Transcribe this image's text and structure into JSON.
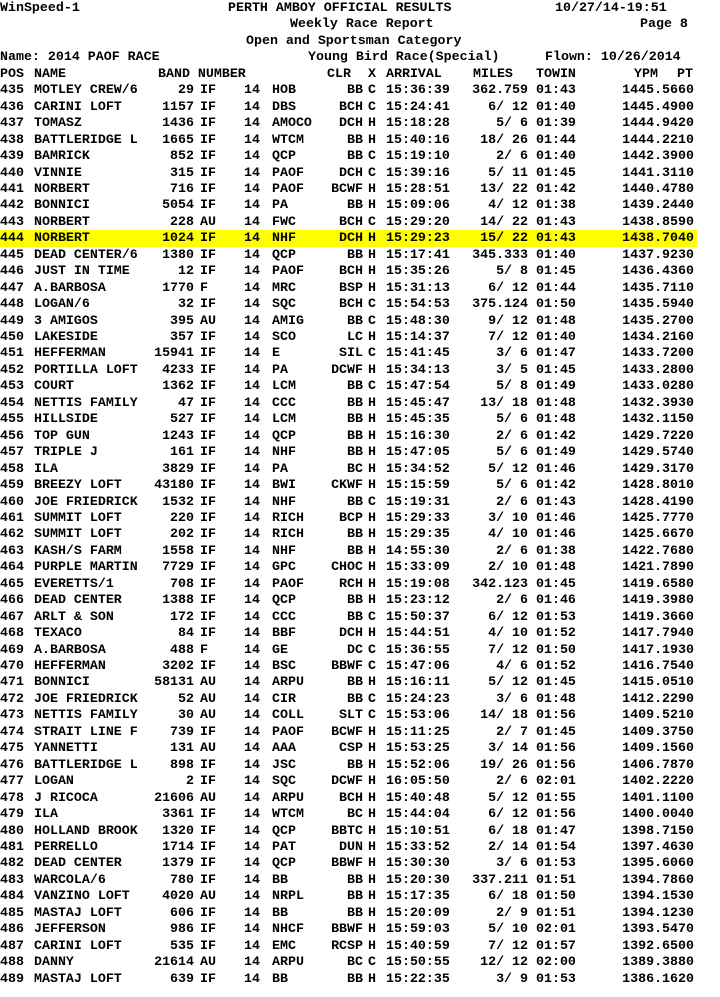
{
  "header": {
    "app": "WinSpeed-1",
    "org": "PERTH AMBOY OFFICIAL RESULTS",
    "datetime": "10/27/14-19:51",
    "report": "Weekly Race Report",
    "page": "Page 8",
    "category": "Open and Sportsman Category",
    "name": "Name: 2014 PAOF RACE",
    "race": "Young Bird Race(Special)",
    "flown": "Flown: 10/26/2014"
  },
  "columns": [
    "POS",
    "NAME",
    "BAND NUMBER",
    "CLR",
    "X",
    "ARRIVAL",
    "MILES",
    "TOWIN",
    "YPM",
    "PT"
  ],
  "highlight_pos": "444",
  "rows": [
    [
      "435",
      "MOTLEY CREW/6",
      "29",
      "IF",
      "14",
      "HOB",
      "BB",
      "C",
      "15:36:39",
      "362.759",
      "01:43",
      "1445.566",
      "0"
    ],
    [
      "436",
      "CARINI LOFT",
      "1157",
      "IF",
      "14",
      "DBS",
      "BCH",
      "C",
      "15:24:41",
      "6/ 12",
      "01:40",
      "1445.490",
      "0"
    ],
    [
      "437",
      "TOMASZ",
      "1436",
      "IF",
      "14",
      "AMOCO",
      "DCH",
      "H",
      "15:18:28",
      "5/ 6",
      "01:39",
      "1444.942",
      "0"
    ],
    [
      "438",
      "BATTLERIDGE L",
      "1665",
      "IF",
      "14",
      "WTCM",
      "BB",
      "H",
      "15:40:16",
      "18/ 26",
      "01:44",
      "1444.221",
      "0"
    ],
    [
      "439",
      "BAMRICK",
      "852",
      "IF",
      "14",
      "QCP",
      "BB",
      "C",
      "15:19:10",
      "2/ 6",
      "01:40",
      "1442.390",
      "0"
    ],
    [
      "440",
      "VINNIE",
      "315",
      "IF",
      "14",
      "PAOF",
      "DCH",
      "C",
      "15:39:16",
      "5/ 11",
      "01:45",
      "1441.311",
      "0"
    ],
    [
      "441",
      "NORBERT",
      "716",
      "IF",
      "14",
      "PAOF",
      "BCWF",
      "H",
      "15:28:51",
      "13/ 22",
      "01:42",
      "1440.478",
      "0"
    ],
    [
      "442",
      "BONNICI",
      "5054",
      "IF",
      "14",
      "PA",
      "BB",
      "H",
      "15:09:06",
      "4/ 12",
      "01:38",
      "1439.244",
      "0"
    ],
    [
      "443",
      "NORBERT",
      "228",
      "AU",
      "14",
      "FWC",
      "BCH",
      "C",
      "15:29:20",
      "14/ 22",
      "01:43",
      "1438.859",
      "0"
    ],
    [
      "444",
      "NORBERT",
      "1024",
      "IF",
      "14",
      "NHF",
      "DCH",
      "H",
      "15:29:23",
      "15/ 22",
      "01:43",
      "1438.704",
      "0"
    ],
    [
      "445",
      "DEAD CENTER/6",
      "1380",
      "IF",
      "14",
      "QCP",
      "BB",
      "H",
      "15:17:41",
      "345.333",
      "01:40",
      "1437.923",
      "0"
    ],
    [
      "446",
      "JUST IN TIME",
      "12",
      "IF",
      "14",
      "PAOF",
      "BCH",
      "H",
      "15:35:26",
      "5/ 8",
      "01:45",
      "1436.436",
      "0"
    ],
    [
      "447",
      "A.BARBOSA",
      "1770",
      "F",
      "14",
      "MRC",
      "BSP",
      "H",
      "15:31:13",
      "6/ 12",
      "01:44",
      "1435.711",
      "0"
    ],
    [
      "448",
      "LOGAN/6",
      "32",
      "IF",
      "14",
      "SQC",
      "BCH",
      "C",
      "15:54:53",
      "375.124",
      "01:50",
      "1435.594",
      "0"
    ],
    [
      "449",
      "3 AMIGOS",
      "395",
      "AU",
      "14",
      "AMIG",
      "BB",
      "C",
      "15:48:30",
      "9/ 12",
      "01:48",
      "1435.270",
      "0"
    ],
    [
      "450",
      "LAKESIDE",
      "357",
      "IF",
      "14",
      "SCO",
      "LC",
      "H",
      "15:14:37",
      "7/ 12",
      "01:40",
      "1434.216",
      "0"
    ],
    [
      "451",
      "HEFFERMAN",
      "15941",
      "IF",
      "14",
      "E",
      "SIL",
      "C",
      "15:41:45",
      "3/ 6",
      "01:47",
      "1433.720",
      "0"
    ],
    [
      "452",
      "PORTILLA LOFT",
      "4233",
      "IF",
      "14",
      "PA",
      "DCWF",
      "H",
      "15:34:13",
      "3/ 5",
      "01:45",
      "1433.280",
      "0"
    ],
    [
      "453",
      "COURT",
      "1362",
      "IF",
      "14",
      "LCM",
      "BB",
      "C",
      "15:47:54",
      "5/ 8",
      "01:49",
      "1433.028",
      "0"
    ],
    [
      "454",
      "NETTIS FAMILY",
      "47",
      "IF",
      "14",
      "CCC",
      "BB",
      "H",
      "15:45:47",
      "13/ 18",
      "01:48",
      "1432.393",
      "0"
    ],
    [
      "455",
      "HILLSIDE",
      "527",
      "IF",
      "14",
      "LCM",
      "BB",
      "H",
      "15:45:35",
      "5/ 6",
      "01:48",
      "1432.115",
      "0"
    ],
    [
      "456",
      "TOP GUN",
      "1243",
      "IF",
      "14",
      "QCP",
      "BB",
      "H",
      "15:16:30",
      "2/ 6",
      "01:42",
      "1429.722",
      "0"
    ],
    [
      "457",
      "TRIPLE J",
      "161",
      "IF",
      "14",
      "NHF",
      "BB",
      "H",
      "15:47:05",
      "5/ 6",
      "01:49",
      "1429.574",
      "0"
    ],
    [
      "458",
      "ILA",
      "3829",
      "IF",
      "14",
      "PA",
      "BC",
      "H",
      "15:34:52",
      "5/ 12",
      "01:46",
      "1429.317",
      "0"
    ],
    [
      "459",
      "BREEZY LOFT",
      "43180",
      "IF",
      "14",
      "BWI",
      "CKWF",
      "H",
      "15:15:59",
      "5/ 6",
      "01:42",
      "1428.801",
      "0"
    ],
    [
      "460",
      "JOE FRIEDRICK",
      "1532",
      "IF",
      "14",
      "NHF",
      "BB",
      "C",
      "15:19:31",
      "2/ 6",
      "01:43",
      "1428.419",
      "0"
    ],
    [
      "461",
      "SUMMIT LOFT",
      "220",
      "IF",
      "14",
      "RICH",
      "BCP",
      "H",
      "15:29:33",
      "3/ 10",
      "01:46",
      "1425.777",
      "0"
    ],
    [
      "462",
      "SUMMIT LOFT",
      "202",
      "IF",
      "14",
      "RICH",
      "BB",
      "H",
      "15:29:35",
      "4/ 10",
      "01:46",
      "1425.667",
      "0"
    ],
    [
      "463",
      "KASH/S FARM",
      "1558",
      "IF",
      "14",
      "NHF",
      "BB",
      "H",
      "14:55:30",
      "2/ 6",
      "01:38",
      "1422.768",
      "0"
    ],
    [
      "464",
      "PURPLE MARTIN",
      "7729",
      "IF",
      "14",
      "GPC",
      "CHOC",
      "H",
      "15:33:09",
      "2/ 10",
      "01:48",
      "1421.789",
      "0"
    ],
    [
      "465",
      "EVERETTS/1",
      "708",
      "IF",
      "14",
      "PAOF",
      "RCH",
      "H",
      "15:19:08",
      "342.123",
      "01:45",
      "1419.658",
      "0"
    ],
    [
      "466",
      "DEAD CENTER",
      "1388",
      "IF",
      "14",
      "QCP",
      "BB",
      "H",
      "15:23:12",
      "2/ 6",
      "01:46",
      "1419.398",
      "0"
    ],
    [
      "467",
      "ARLT & SON",
      "172",
      "IF",
      "14",
      "CCC",
      "BB",
      "C",
      "15:50:37",
      "6/ 12",
      "01:53",
      "1419.366",
      "0"
    ],
    [
      "468",
      "TEXACO",
      "84",
      "IF",
      "14",
      "BBF",
      "DCH",
      "H",
      "15:44:51",
      "4/ 10",
      "01:52",
      "1417.794",
      "0"
    ],
    [
      "469",
      "A.BARBOSA",
      "488",
      "F",
      "14",
      "GE",
      "DC",
      "C",
      "15:36:55",
      "7/ 12",
      "01:50",
      "1417.193",
      "0"
    ],
    [
      "470",
      "HEFFERMAN",
      "3202",
      "IF",
      "14",
      "BSC",
      "BBWF",
      "C",
      "15:47:06",
      "4/ 6",
      "01:52",
      "1416.754",
      "0"
    ],
    [
      "471",
      "BONNICI",
      "58131",
      "AU",
      "14",
      "ARPU",
      "BB",
      "H",
      "15:16:11",
      "5/ 12",
      "01:45",
      "1415.051",
      "0"
    ],
    [
      "472",
      "JOE FRIEDRICK",
      "52",
      "AU",
      "14",
      "CIR",
      "BB",
      "C",
      "15:24:23",
      "3/ 6",
      "01:48",
      "1412.229",
      "0"
    ],
    [
      "473",
      "NETTIS FAMILY",
      "30",
      "AU",
      "14",
      "COLL",
      "SLT",
      "C",
      "15:53:06",
      "14/ 18",
      "01:56",
      "1409.521",
      "0"
    ],
    [
      "474",
      "STRAIT LINE F",
      "739",
      "IF",
      "14",
      "PAOF",
      "BCWF",
      "H",
      "15:11:25",
      "2/ 7",
      "01:45",
      "1409.375",
      "0"
    ],
    [
      "475",
      "YANNETTI",
      "131",
      "AU",
      "14",
      "AAA",
      "CSP",
      "H",
      "15:53:25",
      "3/ 14",
      "01:56",
      "1409.156",
      "0"
    ],
    [
      "476",
      "BATTLERIDGE L",
      "898",
      "IF",
      "14",
      "JSC",
      "BB",
      "H",
      "15:52:06",
      "19/ 26",
      "01:56",
      "1406.787",
      "0"
    ],
    [
      "477",
      "LOGAN",
      "2",
      "IF",
      "14",
      "SQC",
      "DCWF",
      "H",
      "16:05:50",
      "2/ 6",
      "02:01",
      "1402.222",
      "0"
    ],
    [
      "478",
      "J RICOCA",
      "21606",
      "AU",
      "14",
      "ARPU",
      "BCH",
      "H",
      "15:40:48",
      "5/ 12",
      "01:55",
      "1401.110",
      "0"
    ],
    [
      "479",
      "ILA",
      "3361",
      "IF",
      "14",
      "WTCM",
      "BC",
      "H",
      "15:44:04",
      "6/ 12",
      "01:56",
      "1400.004",
      "0"
    ],
    [
      "480",
      "HOLLAND BROOK",
      "1320",
      "IF",
      "14",
      "QCP",
      "BBTC",
      "H",
      "15:10:51",
      "6/ 18",
      "01:47",
      "1398.715",
      "0"
    ],
    [
      "481",
      "PERRELLO",
      "1714",
      "IF",
      "14",
      "PAT",
      "DUN",
      "H",
      "15:33:52",
      "2/ 14",
      "01:54",
      "1397.463",
      "0"
    ],
    [
      "482",
      "DEAD CENTER",
      "1379",
      "IF",
      "14",
      "QCP",
      "BBWF",
      "H",
      "15:30:30",
      "3/ 6",
      "01:53",
      "1395.606",
      "0"
    ],
    [
      "483",
      "WARCOLA/6",
      "780",
      "IF",
      "14",
      "BB",
      "BB",
      "H",
      "15:20:30",
      "337.211",
      "01:51",
      "1394.786",
      "0"
    ],
    [
      "484",
      "VANZINO LOFT",
      "4020",
      "AU",
      "14",
      "NRPL",
      "BB",
      "H",
      "15:17:35",
      "6/ 18",
      "01:50",
      "1394.153",
      "0"
    ],
    [
      "485",
      "MASTAJ LOFT",
      "606",
      "IF",
      "14",
      "BB",
      "BB",
      "H",
      "15:20:09",
      "2/ 9",
      "01:51",
      "1394.123",
      "0"
    ],
    [
      "486",
      "JEFFERSON",
      "986",
      "IF",
      "14",
      "NHCF",
      "BBWF",
      "H",
      "15:59:03",
      "5/ 10",
      "02:01",
      "1393.547",
      "0"
    ],
    [
      "487",
      "CARINI LOFT",
      "535",
      "IF",
      "14",
      "EMC",
      "RCSP",
      "H",
      "15:40:59",
      "7/ 12",
      "01:57",
      "1392.650",
      "0"
    ],
    [
      "488",
      "DANNY",
      "21614",
      "AU",
      "14",
      "ARPU",
      "BC",
      "C",
      "15:50:55",
      "12/ 12",
      "02:00",
      "1389.388",
      "0"
    ],
    [
      "489",
      "MASTAJ LOFT",
      "639",
      "IF",
      "14",
      "BB",
      "BB",
      "H",
      "15:22:35",
      "3/ 9",
      "01:53",
      "1386.162",
      "0"
    ]
  ]
}
